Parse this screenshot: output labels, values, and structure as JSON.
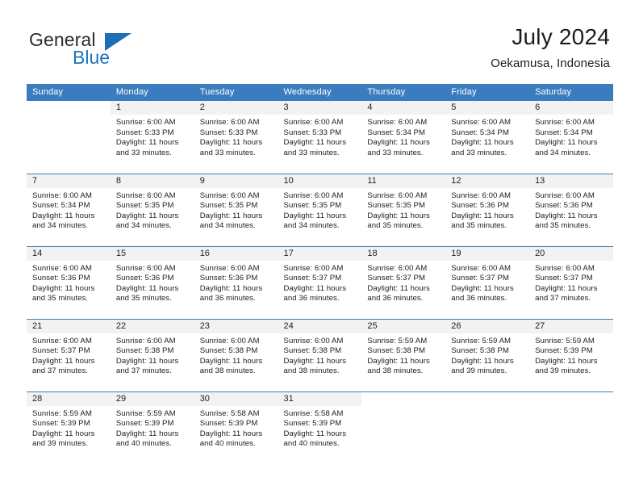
{
  "brand": {
    "name_part1": "General",
    "name_part2": "Blue",
    "accent_color": "#1c74bb",
    "flag_icon": "triangle-flag-icon"
  },
  "header": {
    "title": "July 2024",
    "location": "Oekamusa, Indonesia"
  },
  "colors": {
    "header_row_bg": "#3a7cbe",
    "daynum_strip_bg": "#f2f2f2",
    "grid_line": "#3a7cbe",
    "text": "#222222"
  },
  "weekday_headers": [
    "Sunday",
    "Monday",
    "Tuesday",
    "Wednesday",
    "Thursday",
    "Friday",
    "Saturday"
  ],
  "weeks": [
    [
      {
        "day": "",
        "sunrise": "",
        "sunset": "",
        "daylight_line1": "",
        "daylight_line2": ""
      },
      {
        "day": "1",
        "sunrise": "Sunrise: 6:00 AM",
        "sunset": "Sunset: 5:33 PM",
        "daylight_line1": "Daylight: 11 hours",
        "daylight_line2": "and 33 minutes."
      },
      {
        "day": "2",
        "sunrise": "Sunrise: 6:00 AM",
        "sunset": "Sunset: 5:33 PM",
        "daylight_line1": "Daylight: 11 hours",
        "daylight_line2": "and 33 minutes."
      },
      {
        "day": "3",
        "sunrise": "Sunrise: 6:00 AM",
        "sunset": "Sunset: 5:33 PM",
        "daylight_line1": "Daylight: 11 hours",
        "daylight_line2": "and 33 minutes."
      },
      {
        "day": "4",
        "sunrise": "Sunrise: 6:00 AM",
        "sunset": "Sunset: 5:34 PM",
        "daylight_line1": "Daylight: 11 hours",
        "daylight_line2": "and 33 minutes."
      },
      {
        "day": "5",
        "sunrise": "Sunrise: 6:00 AM",
        "sunset": "Sunset: 5:34 PM",
        "daylight_line1": "Daylight: 11 hours",
        "daylight_line2": "and 33 minutes."
      },
      {
        "day": "6",
        "sunrise": "Sunrise: 6:00 AM",
        "sunset": "Sunset: 5:34 PM",
        "daylight_line1": "Daylight: 11 hours",
        "daylight_line2": "and 34 minutes."
      }
    ],
    [
      {
        "day": "7",
        "sunrise": "Sunrise: 6:00 AM",
        "sunset": "Sunset: 5:34 PM",
        "daylight_line1": "Daylight: 11 hours",
        "daylight_line2": "and 34 minutes."
      },
      {
        "day": "8",
        "sunrise": "Sunrise: 6:00 AM",
        "sunset": "Sunset: 5:35 PM",
        "daylight_line1": "Daylight: 11 hours",
        "daylight_line2": "and 34 minutes."
      },
      {
        "day": "9",
        "sunrise": "Sunrise: 6:00 AM",
        "sunset": "Sunset: 5:35 PM",
        "daylight_line1": "Daylight: 11 hours",
        "daylight_line2": "and 34 minutes."
      },
      {
        "day": "10",
        "sunrise": "Sunrise: 6:00 AM",
        "sunset": "Sunset: 5:35 PM",
        "daylight_line1": "Daylight: 11 hours",
        "daylight_line2": "and 34 minutes."
      },
      {
        "day": "11",
        "sunrise": "Sunrise: 6:00 AM",
        "sunset": "Sunset: 5:35 PM",
        "daylight_line1": "Daylight: 11 hours",
        "daylight_line2": "and 35 minutes."
      },
      {
        "day": "12",
        "sunrise": "Sunrise: 6:00 AM",
        "sunset": "Sunset: 5:36 PM",
        "daylight_line1": "Daylight: 11 hours",
        "daylight_line2": "and 35 minutes."
      },
      {
        "day": "13",
        "sunrise": "Sunrise: 6:00 AM",
        "sunset": "Sunset: 5:36 PM",
        "daylight_line1": "Daylight: 11 hours",
        "daylight_line2": "and 35 minutes."
      }
    ],
    [
      {
        "day": "14",
        "sunrise": "Sunrise: 6:00 AM",
        "sunset": "Sunset: 5:36 PM",
        "daylight_line1": "Daylight: 11 hours",
        "daylight_line2": "and 35 minutes."
      },
      {
        "day": "15",
        "sunrise": "Sunrise: 6:00 AM",
        "sunset": "Sunset: 5:36 PM",
        "daylight_line1": "Daylight: 11 hours",
        "daylight_line2": "and 35 minutes."
      },
      {
        "day": "16",
        "sunrise": "Sunrise: 6:00 AM",
        "sunset": "Sunset: 5:36 PM",
        "daylight_line1": "Daylight: 11 hours",
        "daylight_line2": "and 36 minutes."
      },
      {
        "day": "17",
        "sunrise": "Sunrise: 6:00 AM",
        "sunset": "Sunset: 5:37 PM",
        "daylight_line1": "Daylight: 11 hours",
        "daylight_line2": "and 36 minutes."
      },
      {
        "day": "18",
        "sunrise": "Sunrise: 6:00 AM",
        "sunset": "Sunset: 5:37 PM",
        "daylight_line1": "Daylight: 11 hours",
        "daylight_line2": "and 36 minutes."
      },
      {
        "day": "19",
        "sunrise": "Sunrise: 6:00 AM",
        "sunset": "Sunset: 5:37 PM",
        "daylight_line1": "Daylight: 11 hours",
        "daylight_line2": "and 36 minutes."
      },
      {
        "day": "20",
        "sunrise": "Sunrise: 6:00 AM",
        "sunset": "Sunset: 5:37 PM",
        "daylight_line1": "Daylight: 11 hours",
        "daylight_line2": "and 37 minutes."
      }
    ],
    [
      {
        "day": "21",
        "sunrise": "Sunrise: 6:00 AM",
        "sunset": "Sunset: 5:37 PM",
        "daylight_line1": "Daylight: 11 hours",
        "daylight_line2": "and 37 minutes."
      },
      {
        "day": "22",
        "sunrise": "Sunrise: 6:00 AM",
        "sunset": "Sunset: 5:38 PM",
        "daylight_line1": "Daylight: 11 hours",
        "daylight_line2": "and 37 minutes."
      },
      {
        "day": "23",
        "sunrise": "Sunrise: 6:00 AM",
        "sunset": "Sunset: 5:38 PM",
        "daylight_line1": "Daylight: 11 hours",
        "daylight_line2": "and 38 minutes."
      },
      {
        "day": "24",
        "sunrise": "Sunrise: 6:00 AM",
        "sunset": "Sunset: 5:38 PM",
        "daylight_line1": "Daylight: 11 hours",
        "daylight_line2": "and 38 minutes."
      },
      {
        "day": "25",
        "sunrise": "Sunrise: 5:59 AM",
        "sunset": "Sunset: 5:38 PM",
        "daylight_line1": "Daylight: 11 hours",
        "daylight_line2": "and 38 minutes."
      },
      {
        "day": "26",
        "sunrise": "Sunrise: 5:59 AM",
        "sunset": "Sunset: 5:38 PM",
        "daylight_line1": "Daylight: 11 hours",
        "daylight_line2": "and 39 minutes."
      },
      {
        "day": "27",
        "sunrise": "Sunrise: 5:59 AM",
        "sunset": "Sunset: 5:39 PM",
        "daylight_line1": "Daylight: 11 hours",
        "daylight_line2": "and 39 minutes."
      }
    ],
    [
      {
        "day": "28",
        "sunrise": "Sunrise: 5:59 AM",
        "sunset": "Sunset: 5:39 PM",
        "daylight_line1": "Daylight: 11 hours",
        "daylight_line2": "and 39 minutes."
      },
      {
        "day": "29",
        "sunrise": "Sunrise: 5:59 AM",
        "sunset": "Sunset: 5:39 PM",
        "daylight_line1": "Daylight: 11 hours",
        "daylight_line2": "and 40 minutes."
      },
      {
        "day": "30",
        "sunrise": "Sunrise: 5:58 AM",
        "sunset": "Sunset: 5:39 PM",
        "daylight_line1": "Daylight: 11 hours",
        "daylight_line2": "and 40 minutes."
      },
      {
        "day": "31",
        "sunrise": "Sunrise: 5:58 AM",
        "sunset": "Sunset: 5:39 PM",
        "daylight_line1": "Daylight: 11 hours",
        "daylight_line2": "and 40 minutes."
      },
      {
        "day": "",
        "sunrise": "",
        "sunset": "",
        "daylight_line1": "",
        "daylight_line2": ""
      },
      {
        "day": "",
        "sunrise": "",
        "sunset": "",
        "daylight_line1": "",
        "daylight_line2": ""
      },
      {
        "day": "",
        "sunrise": "",
        "sunset": "",
        "daylight_line1": "",
        "daylight_line2": ""
      }
    ]
  ]
}
